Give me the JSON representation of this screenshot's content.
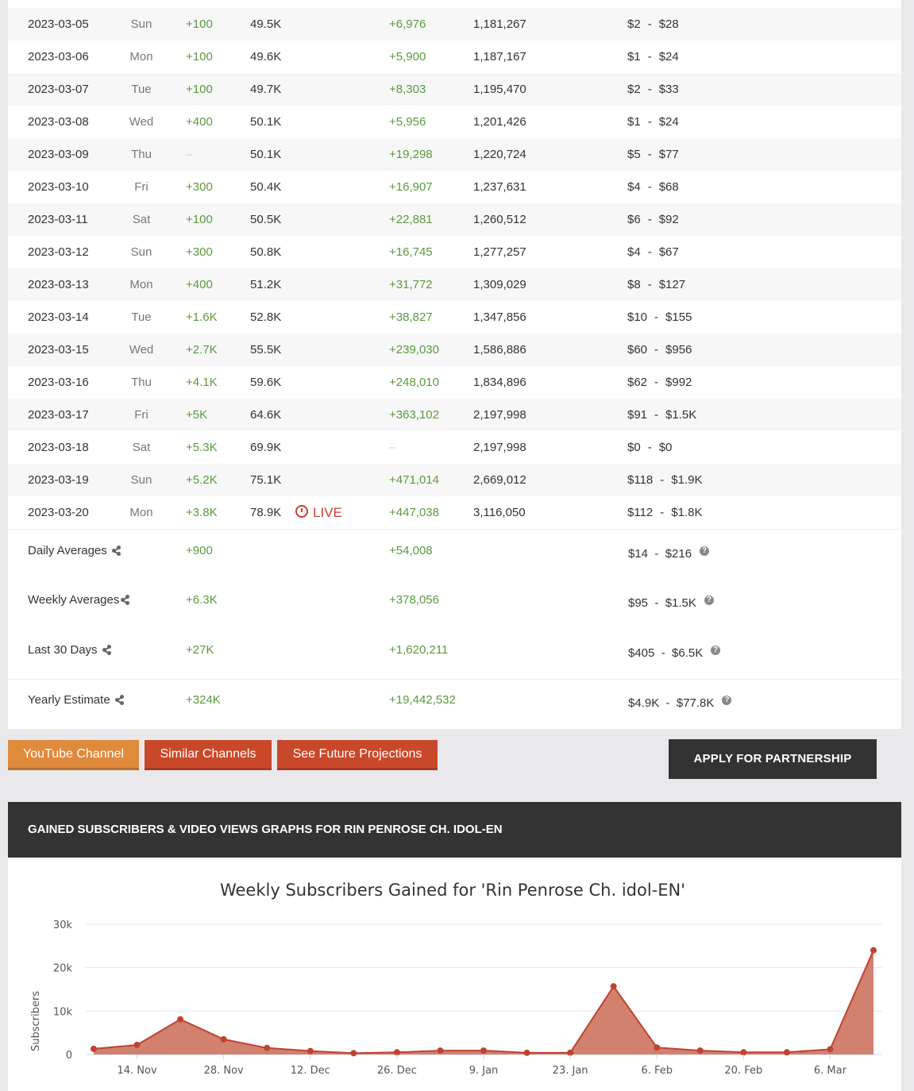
{
  "daily_rows": [
    {
      "date": "2023-03-05",
      "day": "Sun",
      "sub_delta": "+100",
      "subs": "49.5K",
      "live": "",
      "view_delta": "+6,976",
      "views": "1,181,267",
      "earn_low": "$2",
      "earn_high": "$28"
    },
    {
      "date": "2023-03-06",
      "day": "Mon",
      "sub_delta": "+100",
      "subs": "49.6K",
      "live": "",
      "view_delta": "+5,900",
      "views": "1,187,167",
      "earn_low": "$1",
      "earn_high": "$24"
    },
    {
      "date": "2023-03-07",
      "day": "Tue",
      "sub_delta": "+100",
      "subs": "49.7K",
      "live": "",
      "view_delta": "+8,303",
      "views": "1,195,470",
      "earn_low": "$2",
      "earn_high": "$33"
    },
    {
      "date": "2023-03-08",
      "day": "Wed",
      "sub_delta": "+400",
      "subs": "50.1K",
      "live": "",
      "view_delta": "+5,956",
      "views": "1,201,426",
      "earn_low": "$1",
      "earn_high": "$24"
    },
    {
      "date": "2023-03-09",
      "day": "Thu",
      "sub_delta": "--",
      "subs": "50.1K",
      "live": "",
      "view_delta": "+19,298",
      "views": "1,220,724",
      "earn_low": "$5",
      "earn_high": "$77"
    },
    {
      "date": "2023-03-10",
      "day": "Fri",
      "sub_delta": "+300",
      "subs": "50.4K",
      "live": "",
      "view_delta": "+16,907",
      "views": "1,237,631",
      "earn_low": "$4",
      "earn_high": "$68"
    },
    {
      "date": "2023-03-11",
      "day": "Sat",
      "sub_delta": "+100",
      "subs": "50.5K",
      "live": "",
      "view_delta": "+22,881",
      "views": "1,260,512",
      "earn_low": "$6",
      "earn_high": "$92"
    },
    {
      "date": "2023-03-12",
      "day": "Sun",
      "sub_delta": "+300",
      "subs": "50.8K",
      "live": "",
      "view_delta": "+16,745",
      "views": "1,277,257",
      "earn_low": "$4",
      "earn_high": "$67"
    },
    {
      "date": "2023-03-13",
      "day": "Mon",
      "sub_delta": "+400",
      "subs": "51.2K",
      "live": "",
      "view_delta": "+31,772",
      "views": "1,309,029",
      "earn_low": "$8",
      "earn_high": "$127"
    },
    {
      "date": "2023-03-14",
      "day": "Tue",
      "sub_delta": "+1.6K",
      "subs": "52.8K",
      "live": "",
      "view_delta": "+38,827",
      "views": "1,347,856",
      "earn_low": "$10",
      "earn_high": "$155"
    },
    {
      "date": "2023-03-15",
      "day": "Wed",
      "sub_delta": "+2.7K",
      "subs": "55.5K",
      "live": "",
      "view_delta": "+239,030",
      "views": "1,586,886",
      "earn_low": "$60",
      "earn_high": "$956"
    },
    {
      "date": "2023-03-16",
      "day": "Thu",
      "sub_delta": "+4.1K",
      "subs": "59.6K",
      "live": "",
      "view_delta": "+248,010",
      "views": "1,834,896",
      "earn_low": "$62",
      "earn_high": "$992"
    },
    {
      "date": "2023-03-17",
      "day": "Fri",
      "sub_delta": "+5K",
      "subs": "64.6K",
      "live": "",
      "view_delta": "+363,102",
      "views": "2,197,998",
      "earn_low": "$91",
      "earn_high": "$1.5K"
    },
    {
      "date": "2023-03-18",
      "day": "Sat",
      "sub_delta": "+5.3K",
      "subs": "69.9K",
      "live": "",
      "view_delta": "--",
      "views": "2,197,998",
      "earn_low": "$0",
      "earn_high": "$0"
    },
    {
      "date": "2023-03-19",
      "day": "Sun",
      "sub_delta": "+5.2K",
      "subs": "75.1K",
      "live": "",
      "view_delta": "+471,014",
      "views": "2,669,012",
      "earn_low": "$118",
      "earn_high": "$1.9K"
    },
    {
      "date": "2023-03-20",
      "day": "Mon",
      "sub_delta": "+3.8K",
      "subs": "78.9K",
      "live": "LIVE",
      "view_delta": "+447,038",
      "views": "3,116,050",
      "earn_low": "$112",
      "earn_high": "$1.8K"
    }
  ],
  "earn_separator": "-",
  "averages": [
    {
      "label": "Daily Averages",
      "subs": "+900",
      "views": "+54,008",
      "earnings": "$14  -  $216"
    },
    {
      "label": "Weekly Averages",
      "subs": "+6.3K",
      "views": "+378,056",
      "earnings": "$95  -  $1.5K"
    },
    {
      "label": "Last 30 Days",
      "subs": "+27K",
      "views": "+1,620,211",
      "earnings": "$405  -  $6.5K"
    },
    {
      "label": "Yearly Estimate",
      "subs": "+324K",
      "views": "+19,442,532",
      "earnings": "$4.9K  -  $77.8K"
    }
  ],
  "help_glyph": "?",
  "buttons": {
    "youtube": "YouTube Channel",
    "similar": "Similar Channels",
    "future": "See Future Projections",
    "apply": "APPLY FOR PARTNERSHIP"
  },
  "graph_section": {
    "header": "GAINED SUBSCRIBERS & VIDEO VIEWS GRAPHS FOR RIN PENROSE CH. IDOL-EN"
  },
  "colors": {
    "positive": "#5a9a3e",
    "live": "#c9412f",
    "button_orange": "#e08a3c",
    "button_red": "#c9482a",
    "chart_line": "#c0432e",
    "chart_fill": "#cf7a66"
  },
  "chart_data": {
    "type": "area",
    "title": "Weekly Subscribers Gained for 'Rin Penrose Ch. idol-EN'",
    "ylabel": "Subscribers",
    "xlabel": "",
    "ylim": [
      0,
      30000
    ],
    "y_ticks": [
      0,
      10000,
      20000,
      30000
    ],
    "y_tick_labels": [
      "0",
      "10k",
      "20k",
      "30k"
    ],
    "x_tick_labels": [
      "14. Nov",
      "28. Nov",
      "12. Dec",
      "26. Dec",
      "9. Jan",
      "23. Jan",
      "6. Feb",
      "20. Feb",
      "6. Mar"
    ],
    "x_tick_dates": [
      "2022-11-14",
      "2022-11-28",
      "2022-12-12",
      "2022-12-26",
      "2023-01-09",
      "2023-01-23",
      "2023-02-06",
      "2023-02-20",
      "2023-03-06"
    ],
    "grid": true,
    "legend": "none",
    "series": [
      {
        "x": [
          "2022-11-07",
          "2022-11-14",
          "2022-11-21",
          "2022-11-28",
          "2022-12-05",
          "2022-12-12",
          "2022-12-19",
          "2022-12-26",
          "2023-01-02",
          "2023-01-09",
          "2023-01-16",
          "2023-01-23",
          "2023-01-30",
          "2023-02-06",
          "2023-02-13",
          "2023-02-20",
          "2023-02-27",
          "2023-03-06",
          "2023-03-13"
        ],
        "values": [
          1300,
          2200,
          8100,
          3500,
          1500,
          800,
          300,
          500,
          900,
          900,
          400,
          400,
          15700,
          1600,
          900,
          500,
          500,
          1200,
          24000
        ]
      }
    ]
  }
}
